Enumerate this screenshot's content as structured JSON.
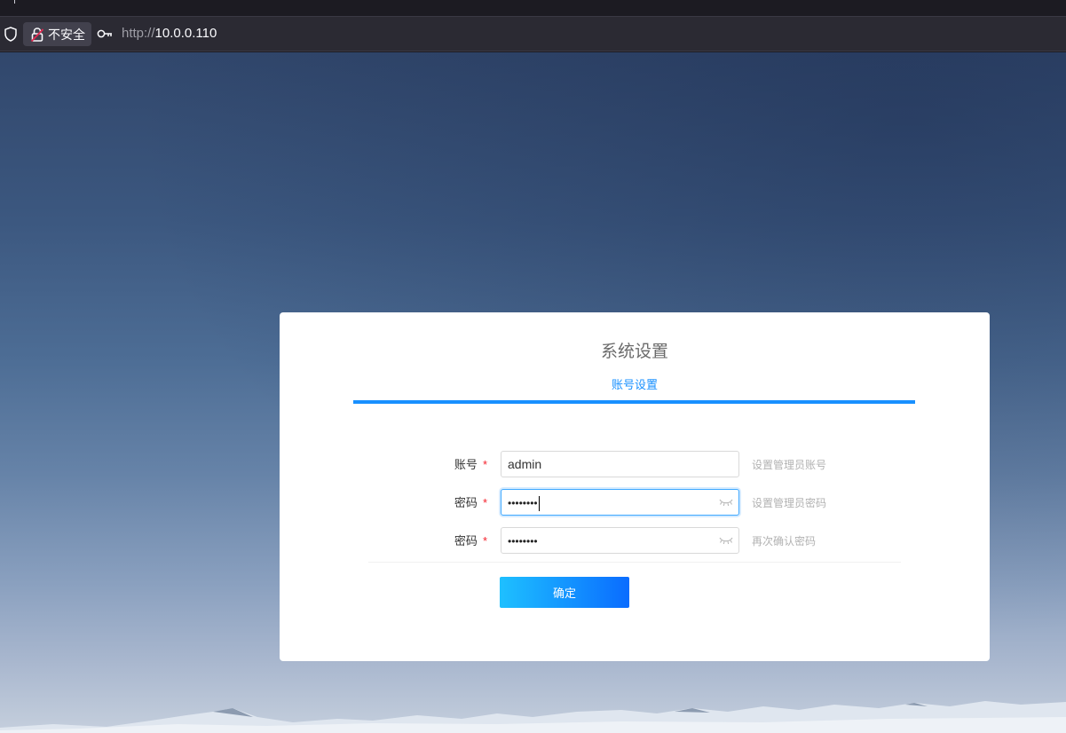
{
  "browser": {
    "security_label": "不安全",
    "url_protocol": "http://",
    "url_host": "10.0.0.110"
  },
  "card": {
    "title": "系统设置",
    "active_tab": "账号设置",
    "accent_color": "#1890ff",
    "fields": [
      {
        "label": "账号",
        "required_mark": "*",
        "value": "admin",
        "hint": "设置管理员账号",
        "type": "text"
      },
      {
        "label": "密码",
        "required_mark": "*",
        "value": "••••••••",
        "hint": "设置管理员密码",
        "type": "password",
        "focused": true,
        "icon": "eye-closed-icon"
      },
      {
        "label": "密码",
        "required_mark": "*",
        "value": "••••••••",
        "hint": "再次确认密码",
        "type": "password",
        "icon": "eye-closed-icon"
      }
    ],
    "submit_label": "确定"
  }
}
